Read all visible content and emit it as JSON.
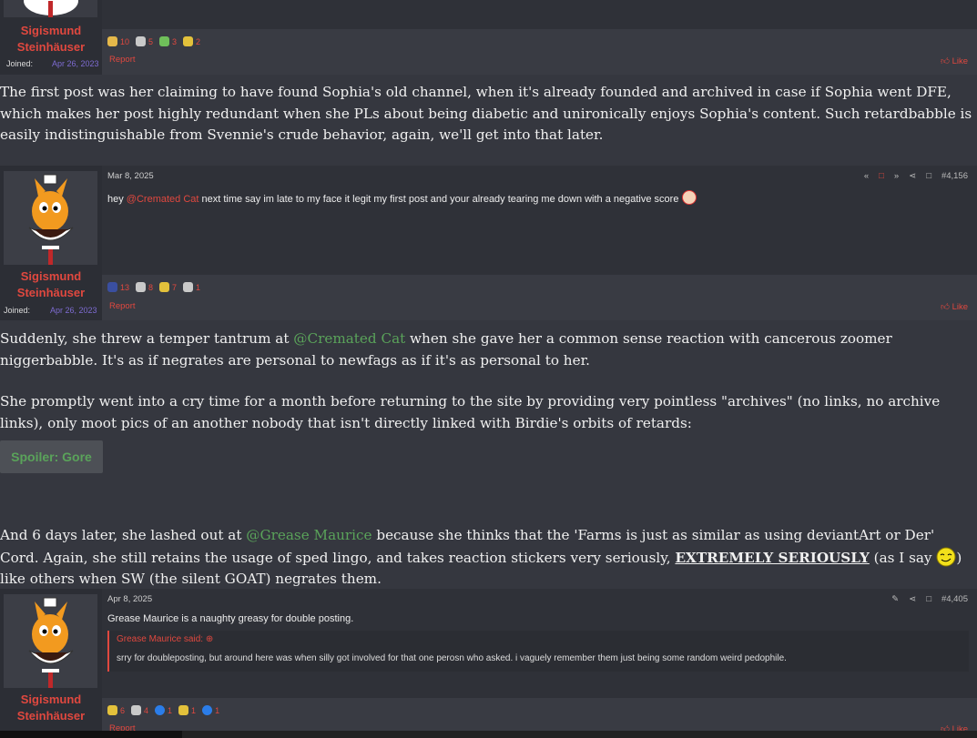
{
  "post1": {
    "username": [
      "Sigismund",
      "Steinhäuser"
    ],
    "joined_label": "Joined:",
    "joined_date": "Apr 26, 2023",
    "reactions": [
      {
        "icon": "clown-icon",
        "count": "10",
        "color": "#e5b84a"
      },
      {
        "icon": "ghost-icon",
        "count": "5",
        "color": "#c9c9c9"
      },
      {
        "icon": "money-icon",
        "count": "3",
        "color": "#6fbf5a"
      },
      {
        "icon": "diamond-icon",
        "count": "2",
        "color": "#e3c13b"
      }
    ],
    "report": "Report",
    "like": "Like"
  },
  "para1": "The first post was her claiming to have found Sophia's old channel, when it's already founded and archived in case if Sophia went DFE, which makes her post highly redundant when she PLs about being diabetic and unironically enjoys Sophia's content. Such retardbabble is easily indistinguishable from Svennie's crude behavior, again, we'll get into that later.",
  "post2": {
    "date": "Mar 8, 2025",
    "post_number": "#4,156",
    "message_pre": "hey ",
    "mention": "@Cremated Cat",
    "message_post": " next time say im late to my face it legit my first post and your already tearing me down with a negative score",
    "username": [
      "Sigismund",
      "Steinhäuser"
    ],
    "joined_label": "Joined:",
    "joined_date": "Apr 26, 2023",
    "reactions": [
      {
        "icon": "hat-icon",
        "count": "13",
        "color": "#3a4fa0"
      },
      {
        "icon": "ghost-icon",
        "count": "8",
        "color": "#c9c9c9"
      },
      {
        "icon": "diamond-icon",
        "count": "7",
        "color": "#e3c13b"
      },
      {
        "icon": "thumbs-down-icon",
        "count": "1",
        "color": "#c9c9c9"
      }
    ],
    "report": "Report",
    "like": "Like"
  },
  "para2": {
    "pre": "Suddenly, she threw a temper tantrum at ",
    "mention": "@Cremated Cat",
    "post": " when she gave her a common sense reaction with cancerous zoomer niggerbabble. It's as if negrates are personal to newfags as if it's as personal to her."
  },
  "para3": "She promptly went into a cry time for a month before returning to the site by providing very pointless \"archives\" (no links, no archive links), only moot pics of an another nobody that isn't directly linked with Birdie's orbits of retards:",
  "spoiler_label": "Spoiler: Gore",
  "para4": {
    "pre": "And 6 days later, she lashed out at ",
    "mention": "@Grease Maurice",
    "mid": " because she thinks that the 'Farms is just as similar as using deviantArt or Der' Cord. Again, she still retains the usage of sped lingo, and takes reaction stickers very seriously, ",
    "emphasis": "EXTREMELY SERIOUSLY",
    "after": " (as I say ",
    "end": ") like others when SW (the silent GOAT) negrates them."
  },
  "post3": {
    "date": "Apr 8, 2025",
    "post_number": "#4,405",
    "message": "Grease Maurice is a naughty greasy for double posting.",
    "quote_author": "Grease Maurice said:",
    "quote_text": "srry for doubleposting, but around here was when silly got involved for that one perosn who asked. i vaguely remember them just being some random weird pedophile.",
    "username": [
      "Sigismund",
      "Steinhäuser"
    ],
    "reactions": [
      {
        "icon": "diamond-icon",
        "count": "6",
        "color": "#e3c13b"
      },
      {
        "icon": "ghost-icon",
        "count": "4",
        "color": "#c9c9c9"
      },
      {
        "icon": "messenger-icon",
        "count": "1",
        "color": "#2b7de9"
      },
      {
        "icon": "pineapple-icon",
        "count": "1",
        "color": "#e3c13b"
      },
      {
        "icon": "info-icon",
        "count": "1",
        "color": "#2b7de9"
      }
    ],
    "report": "Report",
    "like": "Like"
  }
}
